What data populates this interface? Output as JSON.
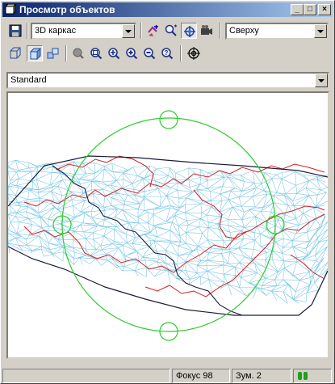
{
  "window": {
    "title": "Просмотр объектов",
    "minimize": "_",
    "maximize": "□",
    "close": "×"
  },
  "toolbar1": {
    "view_mode": "3D каркас",
    "direction": "Сверху"
  },
  "toolbar2": {
    "style": "Standard"
  },
  "status": {
    "focus": "Фокус 98",
    "zoom": "Зум. 2"
  },
  "icons": [
    "save-icon",
    "pick-objects-icon",
    "zoom-extents-icon",
    "orbit-icon",
    "camera-icon",
    "box-view-icon",
    "shaded-box-icon",
    "swivel-icon",
    "pan-icon",
    "zoom-window-icon",
    "zoom-all-icon",
    "zoom-in-icon",
    "zoom-out-icon",
    "zoom-realtime-icon",
    "target-icon"
  ],
  "colors": {
    "mesh": "#7ec8e6",
    "contour": "#d42020",
    "boundary": "#1a1a3a",
    "orbit": "#2ecc2e"
  }
}
